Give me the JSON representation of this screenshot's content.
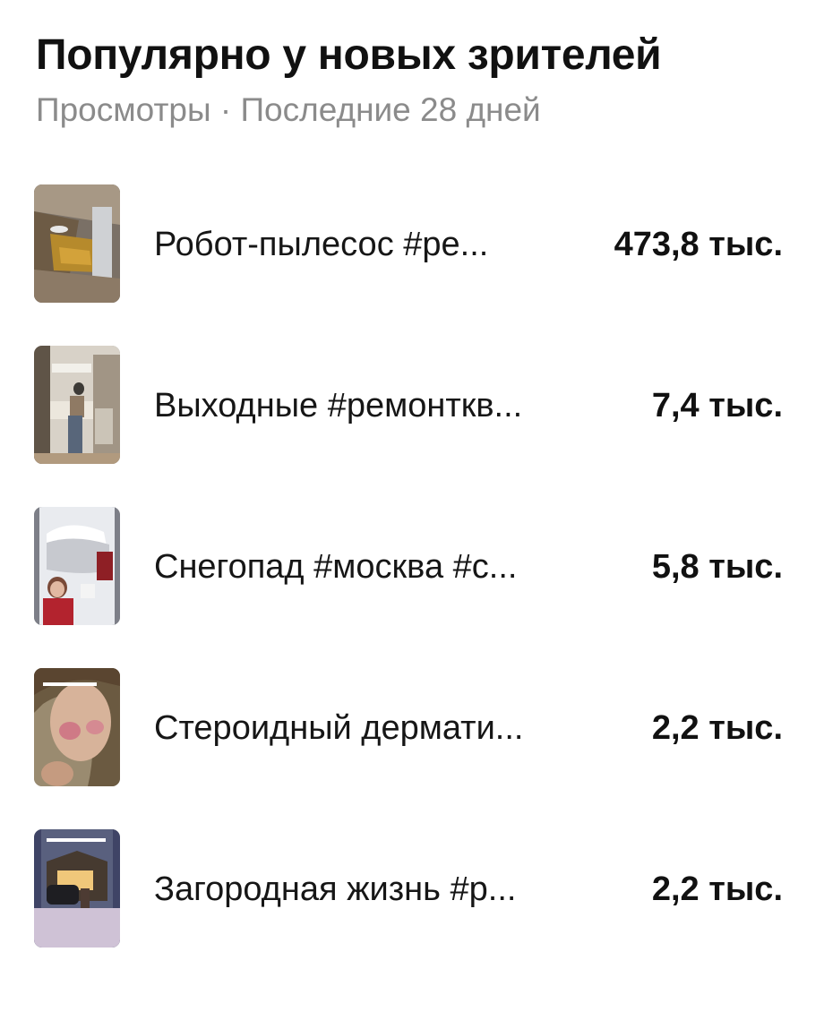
{
  "header": {
    "title": "Популярно у новых зрителей",
    "subtitle": "Просмотры · Последние 28 дней"
  },
  "videos": [
    {
      "title": "Робот-пылесос #ре...",
      "views": "473,8 тыс.",
      "thumbnail_icon": "video-thumbnail-icon"
    },
    {
      "title": "Выходные #ремонткв...",
      "views": "7,4 тыс.",
      "thumbnail_icon": "video-thumbnail-icon"
    },
    {
      "title": "Снегопад #москва #с...",
      "views": "5,8 тыс.",
      "thumbnail_icon": "video-thumbnail-icon"
    },
    {
      "title": "Стероидный дермати...",
      "views": "2,2 тыс.",
      "thumbnail_icon": "video-thumbnail-icon"
    },
    {
      "title": "Загородная жизнь #р...",
      "views": "2,2 тыс.",
      "thumbnail_icon": "video-thumbnail-icon"
    }
  ]
}
